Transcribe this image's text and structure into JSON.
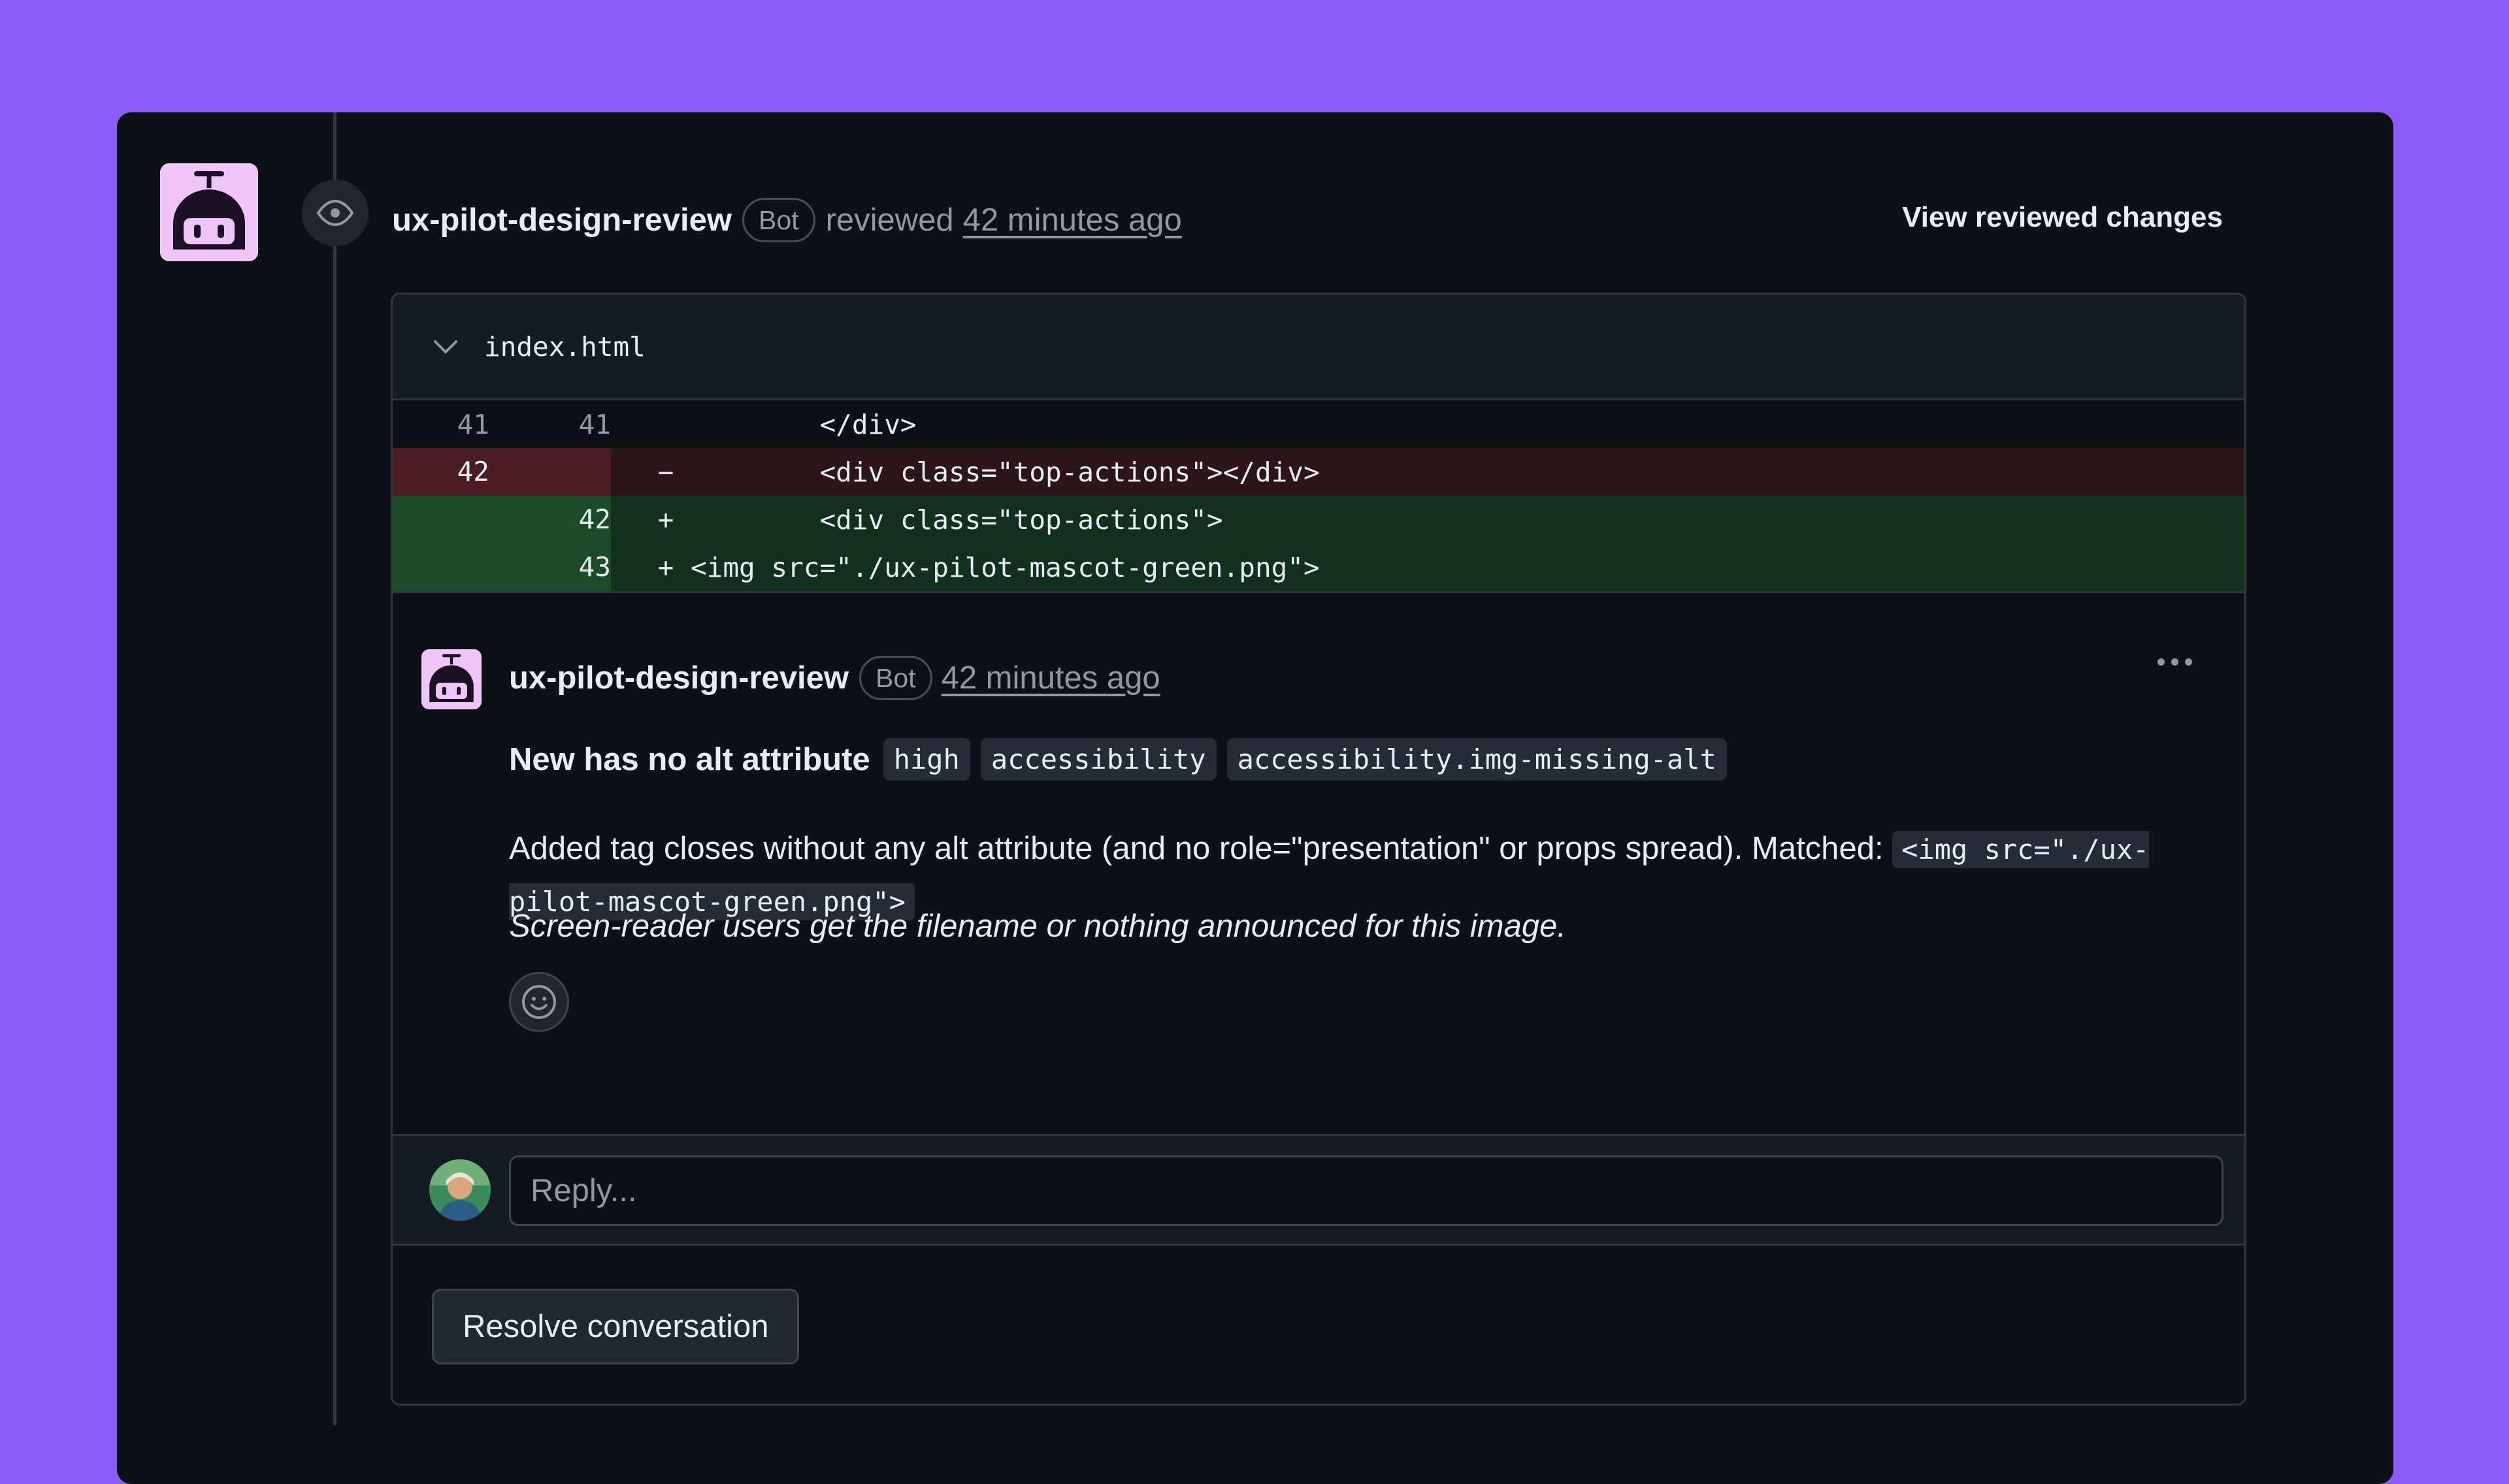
{
  "review": {
    "author": "ux-pilot-design-review",
    "badge": "Bot",
    "action": "reviewed",
    "time": "42 minutes ago",
    "view_link": "View reviewed changes"
  },
  "file": {
    "name": "index.html"
  },
  "diff": [
    {
      "type": "context",
      "old": "41",
      "new": "41",
      "sign": "",
      "code": "        </div>"
    },
    {
      "type": "deletion",
      "old": "42",
      "new": "",
      "sign": "−",
      "code": "        <div class=\"top-actions\"></div>"
    },
    {
      "type": "addition",
      "old": "",
      "new": "42",
      "sign": "+",
      "code": "        <div class=\"top-actions\">"
    },
    {
      "type": "addition",
      "old": "",
      "new": "43",
      "sign": "+",
      "code": "<img src=\"./ux-pilot-mascot-green.png\">"
    }
  ],
  "comment": {
    "author": "ux-pilot-design-review",
    "badge": "Bot",
    "time": "42 minutes ago",
    "title": "New  has no alt attribute",
    "tags": [
      "high",
      "accessibility",
      "accessibility.img-missing-alt"
    ],
    "body_text": "Added  tag closes without any alt attribute (and no role=\"presentation\" or props spread). Matched: ",
    "body_code": "<img src=\"./ux-pilot-mascot-green.png\">",
    "note": "Screen-reader users get the filename or nothing announced for this image."
  },
  "reply": {
    "placeholder": "Reply..."
  },
  "resolve_label": "Resolve conversation"
}
